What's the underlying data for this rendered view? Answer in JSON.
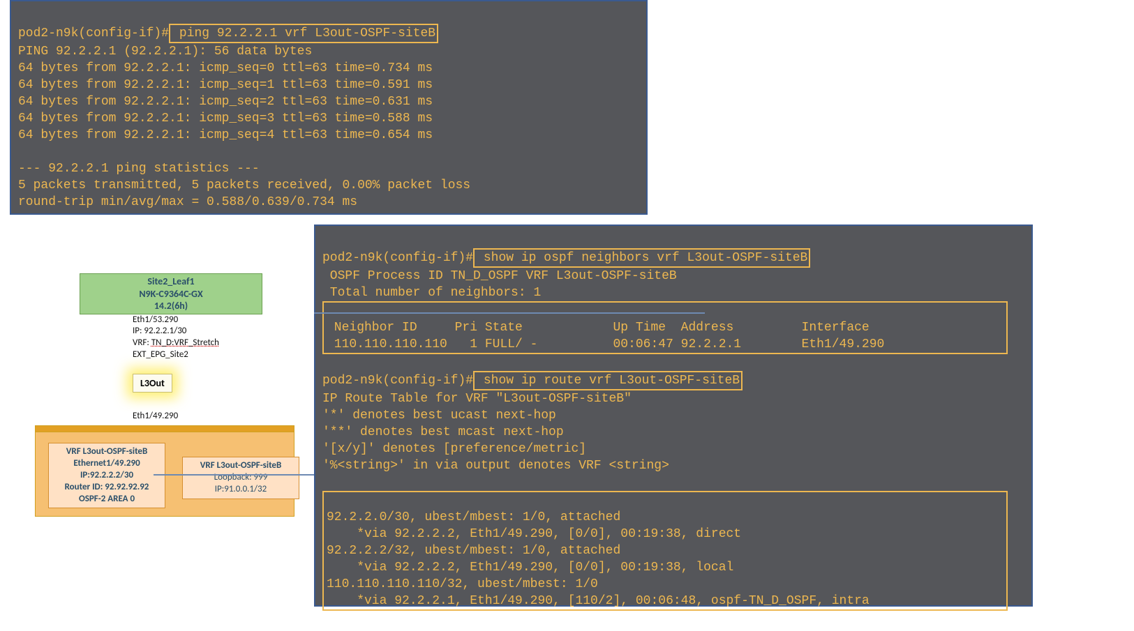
{
  "term1": {
    "prompt": "pod2-n9k(config-if)#",
    "cmd": " ping 92.2.2.1 vrf L3out-OSPF-siteB",
    "lines": [
      "PING 92.2.2.1 (92.2.2.1): 56 data bytes",
      "64 bytes from 92.2.2.1: icmp_seq=0 ttl=63 time=0.734 ms",
      "64 bytes from 92.2.2.1: icmp_seq=1 ttl=63 time=0.591 ms",
      "64 bytes from 92.2.2.1: icmp_seq=2 ttl=63 time=0.631 ms",
      "64 bytes from 92.2.2.1: icmp_seq=3 ttl=63 time=0.588 ms",
      "64 bytes from 92.2.2.1: icmp_seq=4 ttl=63 time=0.654 ms",
      "",
      "--- 92.2.2.1 ping statistics ---",
      "5 packets transmitted, 5 packets received, 0.00% packet loss",
      "round-trip min/avg/max = 0.588/0.639/0.734 ms"
    ]
  },
  "term2": {
    "prompt": "pod2-n9k(config-if)#",
    "cmd1": " show ip ospf neighbors vrf L3out-OSPF-siteB",
    "ospf_lines": [
      " OSPF Process ID TN_D_OSPF VRF L3out-OSPF-siteB",
      " Total number of neighbors: 1"
    ],
    "ospf_headers": " Neighbor ID     Pri State            Up Time  Address         Interface",
    "ospf_row": " 110.110.110.110   1 FULL/ -          00:06:47 92.2.2.1        Eth1/49.290 ",
    "cmd2": " show ip route vrf L3out-OSPF-siteB",
    "route_intro": [
      "IP Route Table for VRF \"L3out-OSPF-siteB\"",
      "'*' denotes best ucast next-hop",
      "'**' denotes best mcast next-hop",
      "'[x/y]' denotes [preference/metric]",
      "'%<string>' in via output denotes VRF <string>"
    ],
    "routes": [
      "92.2.2.0/30, ubest/mbest: 1/0, attached",
      "    *via 92.2.2.2, Eth1/49.290, [0/0], 00:19:38, direct",
      "92.2.2.2/32, ubest/mbest: 1/0, attached",
      "    *via 92.2.2.2, Eth1/49.290, [0/0], 00:19:38, local",
      "110.110.110.110/32, ubest/mbest: 1/0",
      "    *via 92.2.2.1, Eth1/49.290, [110/2], 00:06:48, ospf-TN_D_OSPF, intra"
    ]
  },
  "diagram": {
    "leaf_name": "Site2_Leaf1",
    "leaf_model": "N9K-C9364C-GX",
    "leaf_ver": "14.2(6h)",
    "iface1": "Eth1/53.290",
    "ip1": "IP: 92.2.2.1/30",
    "vrf_label": "VRF:",
    "vrf_val": "TN_D:VRF_Stretch",
    "ext": "EXT_EPG_Site2",
    "l3out": "L3Out",
    "iface2": "Eth1/49.290",
    "vrf_left_title": "VRF L3out-OSPF-siteB",
    "vrf_left_if": "Ethernet1/49.290",
    "vrf_left_ip": "IP:92.2.2.2/30",
    "vrf_left_rid": "Router ID: 92.92.92.92",
    "vrf_left_area": "OSPF-2 AREA 0",
    "vrf_right_title": "VRF L3out-OSPF-siteB",
    "vrf_right_lb": "Loopback: 999",
    "vrf_right_ip": "IP:91.0.0.1/32"
  }
}
